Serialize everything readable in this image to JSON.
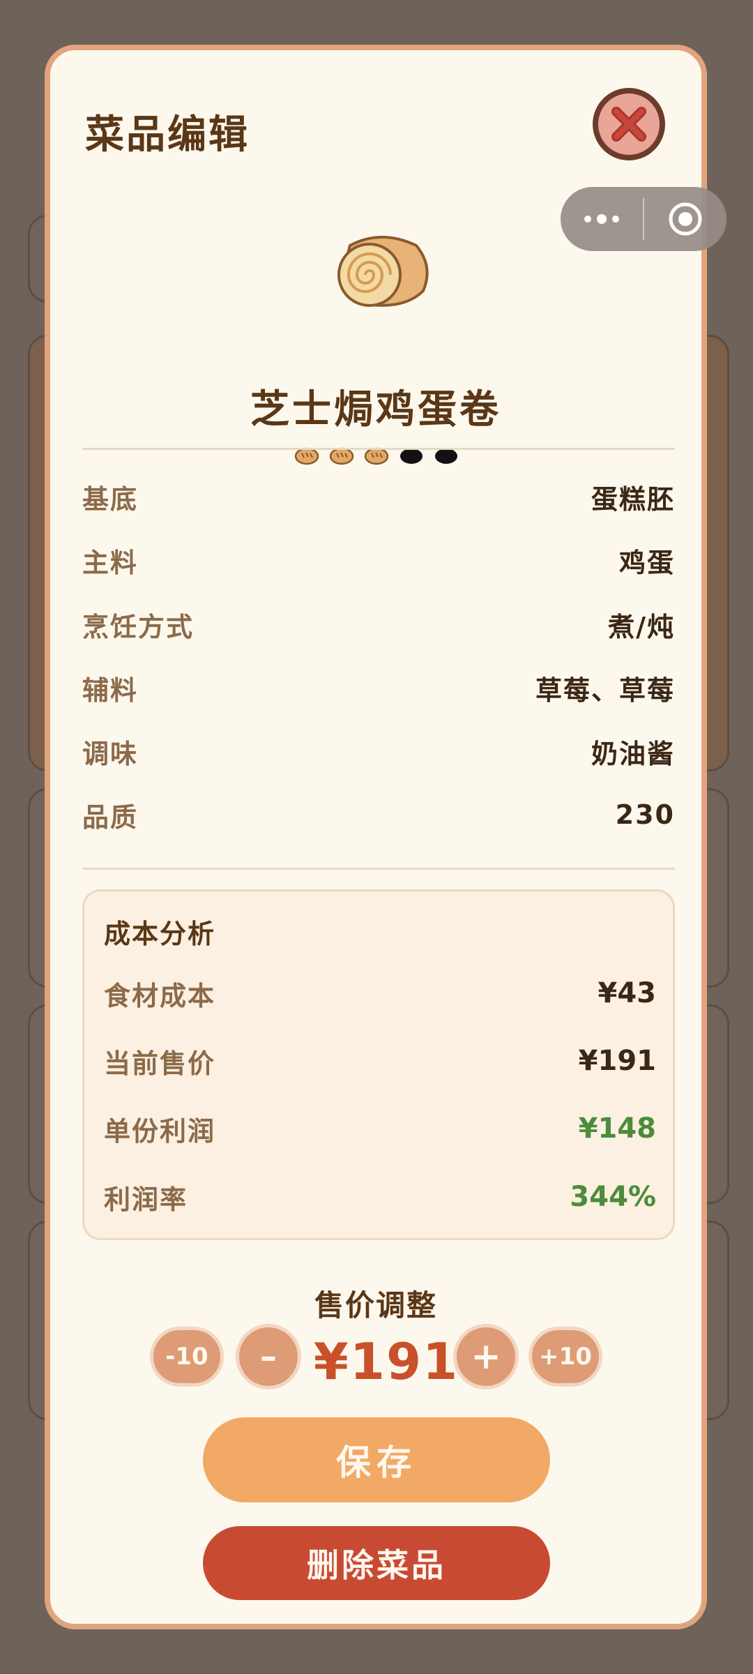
{
  "modal": {
    "title": "菜品编辑",
    "close_icon": "close-icon"
  },
  "capsule": {
    "more_icon": "more-dots-icon",
    "target_icon": "target-icon"
  },
  "dish": {
    "name": "芝士焗鸡蛋卷",
    "image_icon": "swiss-roll-icon",
    "rating": 3,
    "rating_max": 5
  },
  "attributes": [
    {
      "label": "基底",
      "value": "蛋糕胚"
    },
    {
      "label": "主料",
      "value": "鸡蛋"
    },
    {
      "label": "烹饪方式",
      "value": "煮/炖"
    },
    {
      "label": "辅料",
      "value": "草莓、草莓"
    },
    {
      "label": "调味",
      "value": "奶油酱"
    },
    {
      "label": "品质",
      "value": "230"
    }
  ],
  "cost": {
    "title": "成本分析",
    "rows": [
      {
        "label": "食材成本",
        "value": "¥43"
      },
      {
        "label": "当前售价",
        "value": "¥191"
      },
      {
        "label": "单份利润",
        "value": "¥148"
      },
      {
        "label": "利润率",
        "value": "344%"
      }
    ]
  },
  "price_adjust": {
    "title": "售价调整",
    "minus10": "-10",
    "minus": "–",
    "price": "¥191",
    "plus": "+",
    "plus10": "+10"
  },
  "actions": {
    "save": "保存",
    "delete": "删除菜品"
  },
  "colors": {
    "accent": "#f2a966",
    "danger": "#c94a33",
    "profit_green": "#4c8c3c",
    "text_dark": "#5a3716"
  }
}
